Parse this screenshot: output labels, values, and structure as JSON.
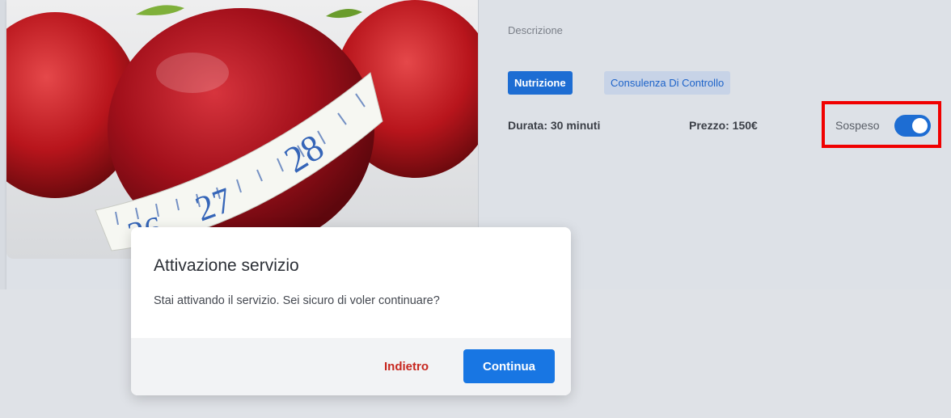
{
  "card": {
    "description_label": "Descrizione",
    "tags": [
      "Nutrizione",
      "Consulenza Di Controllo"
    ],
    "durata": "Durata: 30 minuti",
    "prezzo": "Prezzo: 150€",
    "status_label": "Sospeso",
    "toggle_on": true
  },
  "image": {
    "alt": "Mela con metro da sarta",
    "tape_numbers": [
      "26",
      "27",
      "28"
    ]
  },
  "modal": {
    "title": "Attivazione servizio",
    "body": "Stai attivando il servizio. Sei sicuro di voler continuare?",
    "back_label": "Indietro",
    "continue_label": "Continua"
  },
  "colors": {
    "primary": "#1876e3",
    "danger": "#c7271f",
    "highlight": "#f00000"
  }
}
